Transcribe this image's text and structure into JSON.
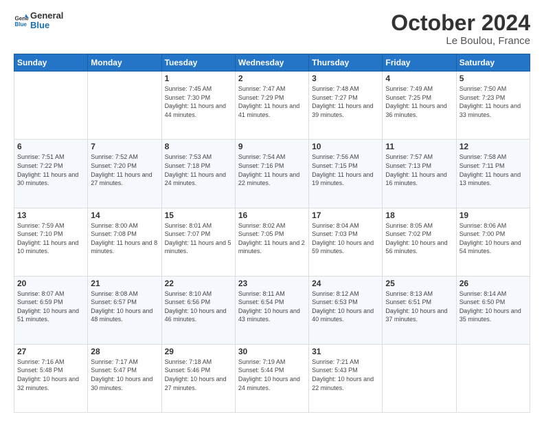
{
  "header": {
    "logo_line1": "General",
    "logo_line2": "Blue",
    "title": "October 2024",
    "subtitle": "Le Boulou, France"
  },
  "weekdays": [
    "Sunday",
    "Monday",
    "Tuesday",
    "Wednesday",
    "Thursday",
    "Friday",
    "Saturday"
  ],
  "weeks": [
    [
      {
        "day": "",
        "info": ""
      },
      {
        "day": "",
        "info": ""
      },
      {
        "day": "1",
        "info": "Sunrise: 7:45 AM\nSunset: 7:30 PM\nDaylight: 11 hours and 44 minutes."
      },
      {
        "day": "2",
        "info": "Sunrise: 7:47 AM\nSunset: 7:29 PM\nDaylight: 11 hours and 41 minutes."
      },
      {
        "day": "3",
        "info": "Sunrise: 7:48 AM\nSunset: 7:27 PM\nDaylight: 11 hours and 39 minutes."
      },
      {
        "day": "4",
        "info": "Sunrise: 7:49 AM\nSunset: 7:25 PM\nDaylight: 11 hours and 36 minutes."
      },
      {
        "day": "5",
        "info": "Sunrise: 7:50 AM\nSunset: 7:23 PM\nDaylight: 11 hours and 33 minutes."
      }
    ],
    [
      {
        "day": "6",
        "info": "Sunrise: 7:51 AM\nSunset: 7:22 PM\nDaylight: 11 hours and 30 minutes."
      },
      {
        "day": "7",
        "info": "Sunrise: 7:52 AM\nSunset: 7:20 PM\nDaylight: 11 hours and 27 minutes."
      },
      {
        "day": "8",
        "info": "Sunrise: 7:53 AM\nSunset: 7:18 PM\nDaylight: 11 hours and 24 minutes."
      },
      {
        "day": "9",
        "info": "Sunrise: 7:54 AM\nSunset: 7:16 PM\nDaylight: 11 hours and 22 minutes."
      },
      {
        "day": "10",
        "info": "Sunrise: 7:56 AM\nSunset: 7:15 PM\nDaylight: 11 hours and 19 minutes."
      },
      {
        "day": "11",
        "info": "Sunrise: 7:57 AM\nSunset: 7:13 PM\nDaylight: 11 hours and 16 minutes."
      },
      {
        "day": "12",
        "info": "Sunrise: 7:58 AM\nSunset: 7:11 PM\nDaylight: 11 hours and 13 minutes."
      }
    ],
    [
      {
        "day": "13",
        "info": "Sunrise: 7:59 AM\nSunset: 7:10 PM\nDaylight: 11 hours and 10 minutes."
      },
      {
        "day": "14",
        "info": "Sunrise: 8:00 AM\nSunset: 7:08 PM\nDaylight: 11 hours and 8 minutes."
      },
      {
        "day": "15",
        "info": "Sunrise: 8:01 AM\nSunset: 7:07 PM\nDaylight: 11 hours and 5 minutes."
      },
      {
        "day": "16",
        "info": "Sunrise: 8:02 AM\nSunset: 7:05 PM\nDaylight: 11 hours and 2 minutes."
      },
      {
        "day": "17",
        "info": "Sunrise: 8:04 AM\nSunset: 7:03 PM\nDaylight: 10 hours and 59 minutes."
      },
      {
        "day": "18",
        "info": "Sunrise: 8:05 AM\nSunset: 7:02 PM\nDaylight: 10 hours and 56 minutes."
      },
      {
        "day": "19",
        "info": "Sunrise: 8:06 AM\nSunset: 7:00 PM\nDaylight: 10 hours and 54 minutes."
      }
    ],
    [
      {
        "day": "20",
        "info": "Sunrise: 8:07 AM\nSunset: 6:59 PM\nDaylight: 10 hours and 51 minutes."
      },
      {
        "day": "21",
        "info": "Sunrise: 8:08 AM\nSunset: 6:57 PM\nDaylight: 10 hours and 48 minutes."
      },
      {
        "day": "22",
        "info": "Sunrise: 8:10 AM\nSunset: 6:56 PM\nDaylight: 10 hours and 46 minutes."
      },
      {
        "day": "23",
        "info": "Sunrise: 8:11 AM\nSunset: 6:54 PM\nDaylight: 10 hours and 43 minutes."
      },
      {
        "day": "24",
        "info": "Sunrise: 8:12 AM\nSunset: 6:53 PM\nDaylight: 10 hours and 40 minutes."
      },
      {
        "day": "25",
        "info": "Sunrise: 8:13 AM\nSunset: 6:51 PM\nDaylight: 10 hours and 37 minutes."
      },
      {
        "day": "26",
        "info": "Sunrise: 8:14 AM\nSunset: 6:50 PM\nDaylight: 10 hours and 35 minutes."
      }
    ],
    [
      {
        "day": "27",
        "info": "Sunrise: 7:16 AM\nSunset: 5:48 PM\nDaylight: 10 hours and 32 minutes."
      },
      {
        "day": "28",
        "info": "Sunrise: 7:17 AM\nSunset: 5:47 PM\nDaylight: 10 hours and 30 minutes."
      },
      {
        "day": "29",
        "info": "Sunrise: 7:18 AM\nSunset: 5:46 PM\nDaylight: 10 hours and 27 minutes."
      },
      {
        "day": "30",
        "info": "Sunrise: 7:19 AM\nSunset: 5:44 PM\nDaylight: 10 hours and 24 minutes."
      },
      {
        "day": "31",
        "info": "Sunrise: 7:21 AM\nSunset: 5:43 PM\nDaylight: 10 hours and 22 minutes."
      },
      {
        "day": "",
        "info": ""
      },
      {
        "day": "",
        "info": ""
      }
    ]
  ]
}
